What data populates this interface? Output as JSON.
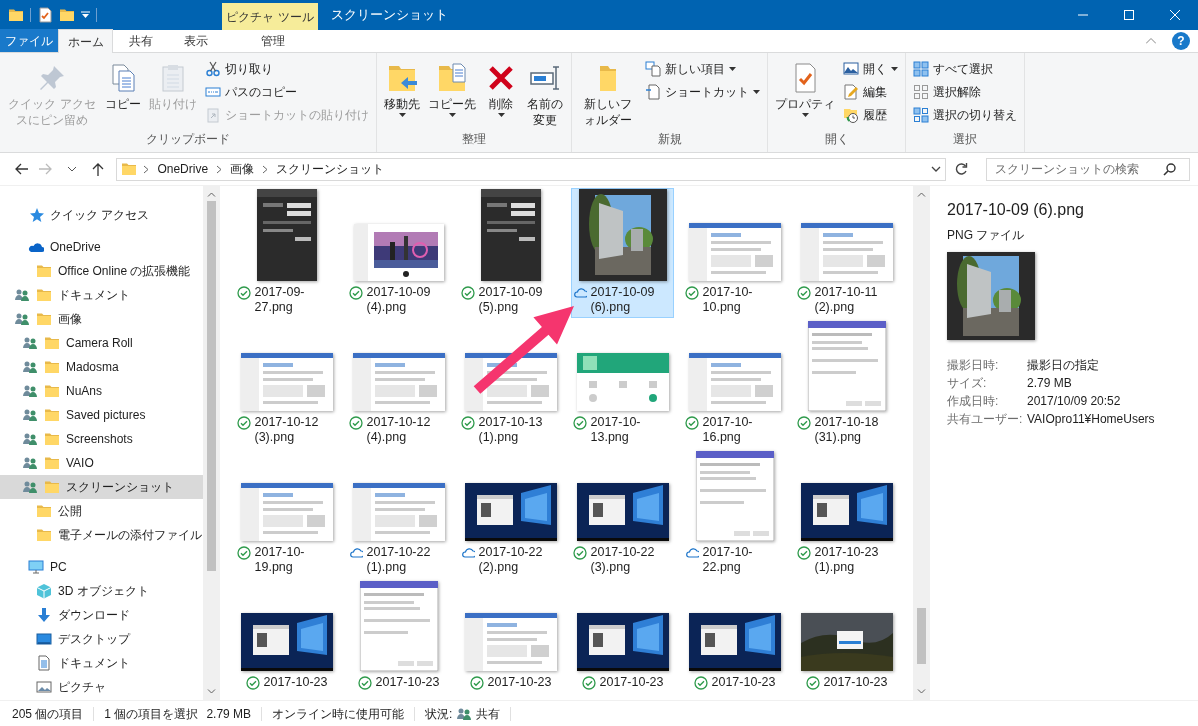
{
  "window": {
    "title": "スクリーンショット",
    "context_tab": "ピクチャ ツール"
  },
  "ribbon_tabs": [
    {
      "label": "ファイル",
      "kind": "file",
      "selected": false
    },
    {
      "label": "ホーム",
      "kind": "tab",
      "selected": true
    },
    {
      "label": "共有",
      "kind": "tab",
      "selected": false
    },
    {
      "label": "表示",
      "kind": "tab",
      "selected": false
    },
    {
      "label": "管理",
      "kind": "contextual",
      "selected": false
    }
  ],
  "help": "?",
  "ribbon_groups": [
    {
      "label": "クリップボード",
      "items": [
        {
          "kind": "large",
          "label": "クイック アクセスにピン留め",
          "disabled": true,
          "dropdown": false
        },
        {
          "kind": "large",
          "label": "コピー",
          "disabled": false,
          "dropdown": false
        },
        {
          "kind": "large",
          "label": "貼り付け",
          "disabled": true,
          "dropdown": false
        },
        {
          "kind": "stack",
          "buttons": [
            {
              "label": "切り取り",
              "disabled": false,
              "dropdown": false
            },
            {
              "label": "パスのコピー",
              "disabled": false,
              "dropdown": false
            },
            {
              "label": "ショートカットの貼り付け",
              "disabled": true,
              "dropdown": false
            }
          ]
        }
      ]
    },
    {
      "label": "整理",
      "items": [
        {
          "kind": "large",
          "label": "移動先",
          "disabled": false,
          "dropdown": true
        },
        {
          "kind": "large",
          "label": "コピー先",
          "disabled": false,
          "dropdown": true
        },
        {
          "kind": "large",
          "label": "削除",
          "disabled": false,
          "dropdown": true
        },
        {
          "kind": "large",
          "label": "名前の変更",
          "disabled": false,
          "dropdown": false
        }
      ]
    },
    {
      "label": "新規",
      "items": [
        {
          "kind": "large",
          "label": "新しいフォルダー",
          "disabled": false,
          "dropdown": false
        },
        {
          "kind": "stack",
          "buttons": [
            {
              "label": "新しい項目",
              "disabled": false,
              "dropdown": true
            },
            {
              "label": "ショートカット",
              "disabled": false,
              "dropdown": true
            }
          ]
        }
      ]
    },
    {
      "label": "開く",
      "items": [
        {
          "kind": "large",
          "label": "プロパティ",
          "disabled": false,
          "dropdown": true
        },
        {
          "kind": "stack",
          "buttons": [
            {
              "label": "開く",
              "disabled": false,
              "dropdown": true
            },
            {
              "label": "編集",
              "disabled": false,
              "dropdown": false
            },
            {
              "label": "履歴",
              "disabled": false,
              "dropdown": false
            }
          ]
        }
      ]
    },
    {
      "label": "選択",
      "items": [
        {
          "kind": "stack",
          "buttons": [
            {
              "label": "すべて選択",
              "disabled": false,
              "dropdown": false
            },
            {
              "label": "選択解除",
              "disabled": false,
              "dropdown": false
            },
            {
              "label": "選択の切り替え",
              "disabled": false,
              "dropdown": false
            }
          ]
        }
      ]
    }
  ],
  "address": {
    "path": [
      "OneDrive",
      "画像",
      "スクリーンショット"
    ]
  },
  "search": {
    "placeholder": "スクリーンショットの検索"
  },
  "navigation": [
    {
      "label": "クイック アクセス",
      "kind": "quick-access",
      "shared": false,
      "selected": false
    },
    {
      "label": "OneDrive",
      "kind": "onedrive",
      "shared": false,
      "selected": false,
      "children": [
        {
          "label": "Office Online の拡張機能",
          "kind": "folder",
          "shared": false,
          "selected": false
        },
        {
          "label": "ドキュメント",
          "kind": "folder",
          "shared": true,
          "selected": false
        },
        {
          "label": "画像",
          "kind": "folder",
          "shared": true,
          "selected": false,
          "children": [
            {
              "label": "Camera Roll",
              "kind": "folder",
              "shared": true,
              "selected": false
            },
            {
              "label": "Madosma",
              "kind": "folder",
              "shared": true,
              "selected": false
            },
            {
              "label": "NuAns",
              "kind": "folder",
              "shared": true,
              "selected": false
            },
            {
              "label": "Saved pictures",
              "kind": "folder",
              "shared": true,
              "selected": false
            },
            {
              "label": "Screenshots",
              "kind": "folder",
              "shared": true,
              "selected": false
            },
            {
              "label": "VAIO",
              "kind": "folder",
              "shared": true,
              "selected": false
            },
            {
              "label": "スクリーンショット",
              "kind": "folder",
              "shared": true,
              "selected": true
            }
          ]
        },
        {
          "label": "公開",
          "kind": "folder",
          "shared": false,
          "selected": false
        },
        {
          "label": "電子メールの添付ファイル",
          "kind": "folder",
          "shared": false,
          "selected": false
        }
      ]
    },
    {
      "label": "PC",
      "kind": "pc",
      "shared": false,
      "selected": false,
      "children": [
        {
          "label": "3D オブジェクト",
          "kind": "objects-3d",
          "shared": false,
          "selected": false
        },
        {
          "label": "ダウンロード",
          "kind": "downloads",
          "shared": false,
          "selected": false
        },
        {
          "label": "デスクトップ",
          "kind": "desktop",
          "shared": false,
          "selected": false
        },
        {
          "label": "ドキュメント",
          "kind": "documents",
          "shared": false,
          "selected": false
        },
        {
          "label": "ピクチャ",
          "kind": "pictures",
          "shared": false,
          "selected": false
        }
      ]
    }
  ],
  "files": [
    {
      "name": "2017-09-27.png",
      "kind": "synced",
      "selected": false
    },
    {
      "name": "2017-10-09 (4).png",
      "kind": "synced",
      "selected": false
    },
    {
      "name": "2017-10-09 (5).png",
      "kind": "synced",
      "selected": false
    },
    {
      "name": "2017-10-09 (6).png",
      "kind": "online",
      "selected": true
    },
    {
      "name": "2017-10-10.png",
      "kind": "synced",
      "selected": false
    },
    {
      "name": "2017-10-11 (2).png",
      "kind": "synced",
      "selected": false
    },
    {
      "name": "2017-10-12 (3).png",
      "kind": "synced",
      "selected": false
    },
    {
      "name": "2017-10-12 (4).png",
      "kind": "synced",
      "selected": false
    },
    {
      "name": "2017-10-13 (1).png",
      "kind": "synced",
      "selected": false
    },
    {
      "name": "2017-10-13.png",
      "kind": "synced",
      "selected": false
    },
    {
      "name": "2017-10-16.png",
      "kind": "synced",
      "selected": false
    },
    {
      "name": "2017-10-18 (31).png",
      "kind": "synced",
      "selected": false
    },
    {
      "name": "2017-10-19.png",
      "kind": "synced",
      "selected": false
    },
    {
      "name": "2017-10-22 (1).png",
      "kind": "online",
      "selected": false
    },
    {
      "name": "2017-10-22 (2).png",
      "kind": "online",
      "selected": false
    },
    {
      "name": "2017-10-22 (3).png",
      "kind": "synced",
      "selected": false
    },
    {
      "name": "2017-10-22.png",
      "kind": "online",
      "selected": false
    },
    {
      "name": "2017-10-23 (1).png",
      "kind": "synced",
      "selected": false
    },
    {
      "name": "2017-10-23",
      "kind": "synced",
      "selected": false
    },
    {
      "name": "2017-10-23",
      "kind": "synced",
      "selected": false
    },
    {
      "name": "2017-10-23",
      "kind": "synced",
      "selected": false
    },
    {
      "name": "2017-10-23",
      "kind": "synced",
      "selected": false
    },
    {
      "name": "2017-10-23",
      "kind": "synced",
      "selected": false
    },
    {
      "name": "2017-10-23",
      "kind": "synced",
      "selected": false
    }
  ],
  "annotation": {
    "kind": "arrow"
  },
  "details": {
    "title": "2017-10-09 (6).png",
    "type": "PNG ファイル",
    "properties": [
      {
        "label": "撮影日時:",
        "value": "撮影日の指定"
      },
      {
        "label": "サイズ:",
        "value": "2.79 MB"
      },
      {
        "label": "作成日時:",
        "value": "2017/10/09 20:52"
      },
      {
        "label": "共有ユーザー:",
        "value": "VAIOpro11¥HomeUsers"
      }
    ]
  },
  "status_bar": {
    "item_count": "205 個の項目",
    "selection": "1 個の項目を選択",
    "selection_size": "2.79 MB",
    "availability": "オンライン時に使用可能",
    "state_label": "状況:",
    "state_value": "共有"
  }
}
